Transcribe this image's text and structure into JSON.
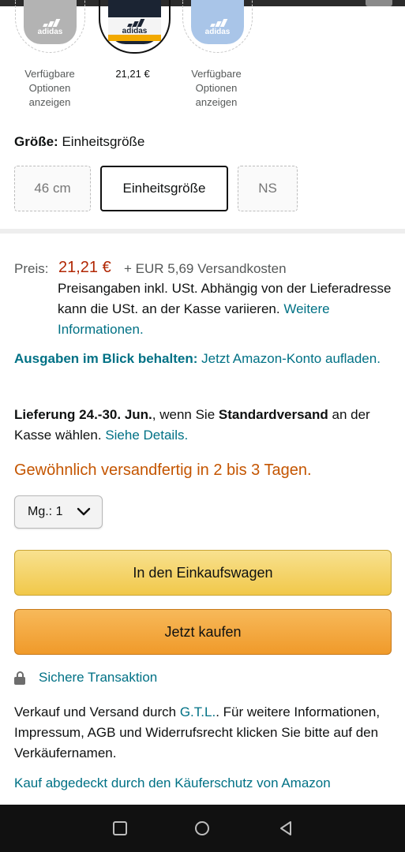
{
  "variants": [
    {
      "label_lines": [
        "Verfügbare",
        "Optionen",
        "anzeigen"
      ],
      "logo": "adidas",
      "color": "#b3b3b3"
    },
    {
      "price": "21,21 €",
      "logo": "adidas",
      "color": "#1b2433",
      "selected": true
    },
    {
      "label_lines": [
        "Verfügbare",
        "Optionen",
        "anzeigen"
      ],
      "logo": "adidas",
      "color": "#a9c5e8"
    }
  ],
  "size": {
    "label": "Größe:",
    "selected": "Einheitsgröße",
    "options": [
      "46 cm",
      "Einheitsgröße",
      "NS"
    ]
  },
  "price": {
    "label": "Preis:",
    "value": "21,21 €",
    "shipping": "+ EUR 5,69 Versandkosten",
    "tax_note": "Preisangaben inkl. USt. Abhängig von der Lieferadresse kann die USt. an der Kasse variieren.",
    "tax_link": "Weitere Informationen."
  },
  "wallet": {
    "bold": "Ausgaben im Blick behalten:",
    "text": "Jetzt Amazon-Konto aufladen."
  },
  "delivery": {
    "bold_date": "Lieferung 24.-30. Jun.",
    "mid": ", wenn Sie",
    "bold_method": "Standardversand",
    "end": "an der Kasse wählen.",
    "link": "Siehe Details."
  },
  "availability": "Gewöhnlich versandfertig in 2 bis 3 Tagen.",
  "quantity": {
    "label": "Mg.:",
    "value": "1"
  },
  "buttons": {
    "cart": "In den Einkaufswagen",
    "buy": "Jetzt kaufen"
  },
  "secure": "Sichere Transaktion",
  "seller": {
    "pre": "Verkauf und Versand durch",
    "name": "G.T.L.",
    "post": ". Für weitere Informationen, Impressum, AGB und Widerrufsrecht klicken Sie bitte auf den Verkäufernamen."
  },
  "protection": "Kauf abgedeckt durch den Käuferschutz von Amazon",
  "colors": {
    "link": "#007185",
    "price": "#b12704",
    "availability": "#c45500",
    "cart": "#f1c84a",
    "buy": "#f09a2a"
  },
  "icons": [
    "lock-icon",
    "chevron-down-icon",
    "nav-recent-icon",
    "nav-home-icon",
    "nav-back-icon",
    "adidas-logo-icon"
  ]
}
